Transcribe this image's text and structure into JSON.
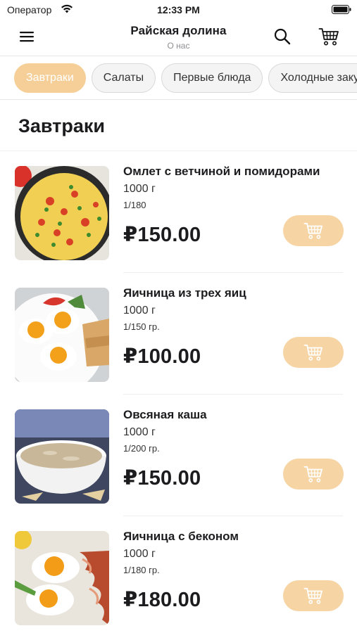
{
  "status_bar": {
    "carrier": "Оператор",
    "time": "12:33 PM"
  },
  "header": {
    "title": "Райская долина",
    "subtitle": "О нас"
  },
  "categories": [
    "Завтраки",
    "Салаты",
    "Первые блюда",
    "Холодные закуски"
  ],
  "active_category": "Завтраки",
  "section": {
    "title": "Завтраки"
  },
  "products": [
    {
      "name": "Омлет с ветчиной и помидорами",
      "weight": "1000 г",
      "portion": "1/180",
      "price": "₽150.00",
      "image": "omelette"
    },
    {
      "name": "Яичница из трех яиц",
      "weight": "1000 г",
      "portion": "1/150 гр.",
      "price": "₽100.00",
      "image": "fried-eggs"
    },
    {
      "name": "Овсяная каша",
      "weight": "1000 г",
      "portion": "1/200 гр.",
      "price": "₽150.00",
      "image": "oatmeal"
    },
    {
      "name": "Яичница с беконом",
      "weight": "1000 г",
      "portion": "1/180 гр.",
      "price": "₽180.00",
      "image": "eggs-bacon"
    }
  ],
  "icons": {
    "menu": "hamburger-menu-icon",
    "search": "search-icon",
    "cart": "shopping-cart-icon",
    "add_to_cart": "cart-add-icon",
    "wifi": "wifi-icon",
    "battery": "battery-icon"
  },
  "colors": {
    "accent": "#f6cf98",
    "add_button": "#f6d4a4",
    "text": "#1c1c1e",
    "muted": "#8e8e93"
  }
}
